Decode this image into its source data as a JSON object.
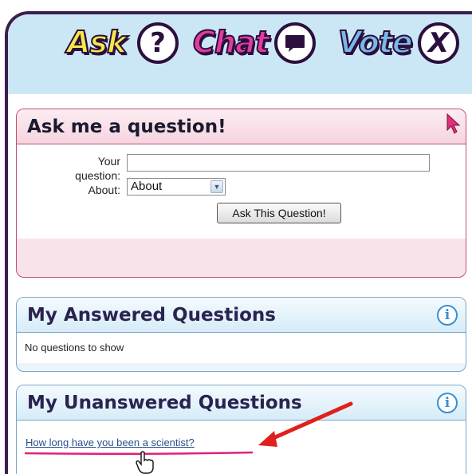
{
  "header": {
    "logos": [
      {
        "word": "Ask",
        "symbol": "?",
        "color": "#f6e84a",
        "icon": "question-icon"
      },
      {
        "word": "Chat",
        "symbol": "",
        "color": "#e03ca0",
        "icon": "chat-bubble-icon"
      },
      {
        "word": "Vote",
        "symbol": "X",
        "color": "#7ab8e8",
        "icon": "x-icon"
      }
    ]
  },
  "ask_panel": {
    "title": "Ask me a question!",
    "question_label_line1": "Your",
    "question_label_line2": "question:",
    "about_label": "About:",
    "question_value": "",
    "about_selected": "About",
    "submit_label": "Ask This Question!"
  },
  "answered_panel": {
    "title": "My Answered Questions",
    "empty_text": "No questions to show"
  },
  "unanswered_panel": {
    "title": "My Unanswered Questions",
    "items": [
      "How long have you been a scientist?"
    ]
  },
  "colors": {
    "header_bg": "#cbe7f5",
    "frame": "#3a1f4d",
    "ask_panel_border": "#c0506e",
    "annotation_arrow": "#e0201c"
  }
}
